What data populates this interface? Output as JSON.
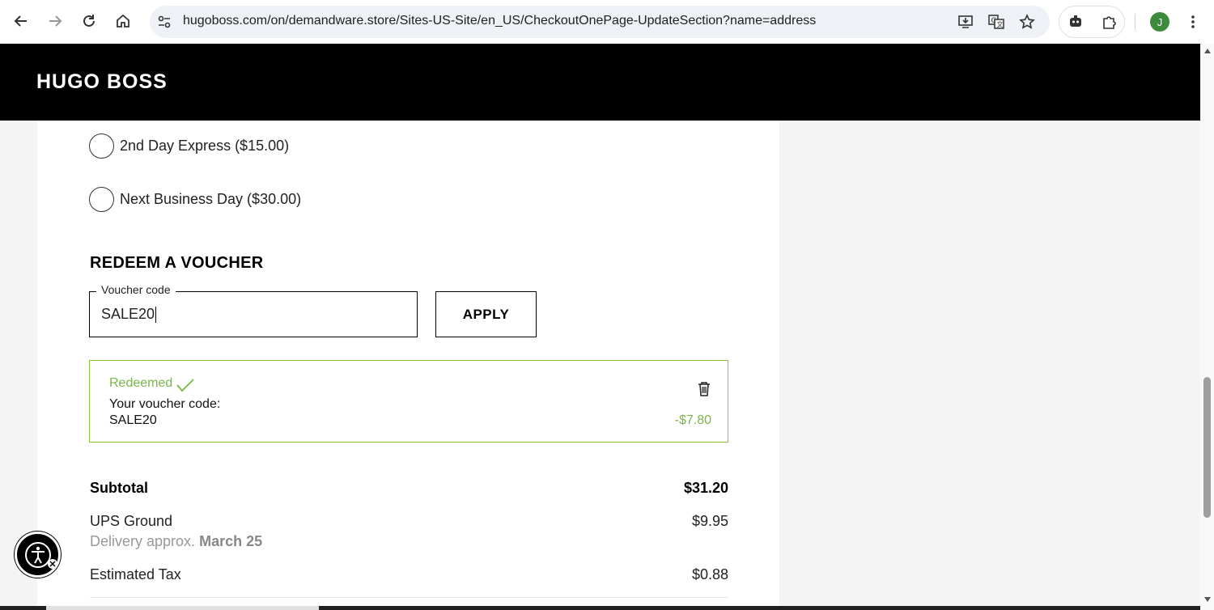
{
  "browser": {
    "url": "hugoboss.com/on/demandware.store/Sites-US-Site/en_US/CheckoutOnePage-UpdateSection?name=address",
    "profile_initial": "J"
  },
  "site": {
    "logo": "HUGO BOSS"
  },
  "shipping_options": [
    {
      "label": "2nd Day Express ($15.00)",
      "selected": false
    },
    {
      "label": "Next Business Day ($30.00)",
      "selected": false
    }
  ],
  "voucher": {
    "title": "REDEEM A VOUCHER",
    "field_label": "Voucher code",
    "field_value": "SALE20",
    "apply_label": "APPLY",
    "redeemed_label": "Redeemed",
    "code_label": "Your voucher code:",
    "code_value": "SALE20",
    "discount": "-$7.80"
  },
  "summary": {
    "subtotal_label": "Subtotal",
    "subtotal_value": "$31.20",
    "shipping_label": "UPS Ground",
    "shipping_value": "$9.95",
    "delivery_prefix": "Delivery approx.",
    "delivery_date": "March 25",
    "tax_label": "Estimated Tax",
    "tax_value": "$0.88"
  },
  "colors": {
    "accent_green": "#7ab648",
    "header_bg": "#000000"
  },
  "icons": [
    "back-icon",
    "forward-icon",
    "reload-icon",
    "home-icon",
    "site-info-icon",
    "install-icon",
    "translate-icon",
    "bookmark-star-icon",
    "extension-icon",
    "puzzle-icon",
    "more-icon",
    "check-icon",
    "trash-icon",
    "accessibility-icon"
  ]
}
